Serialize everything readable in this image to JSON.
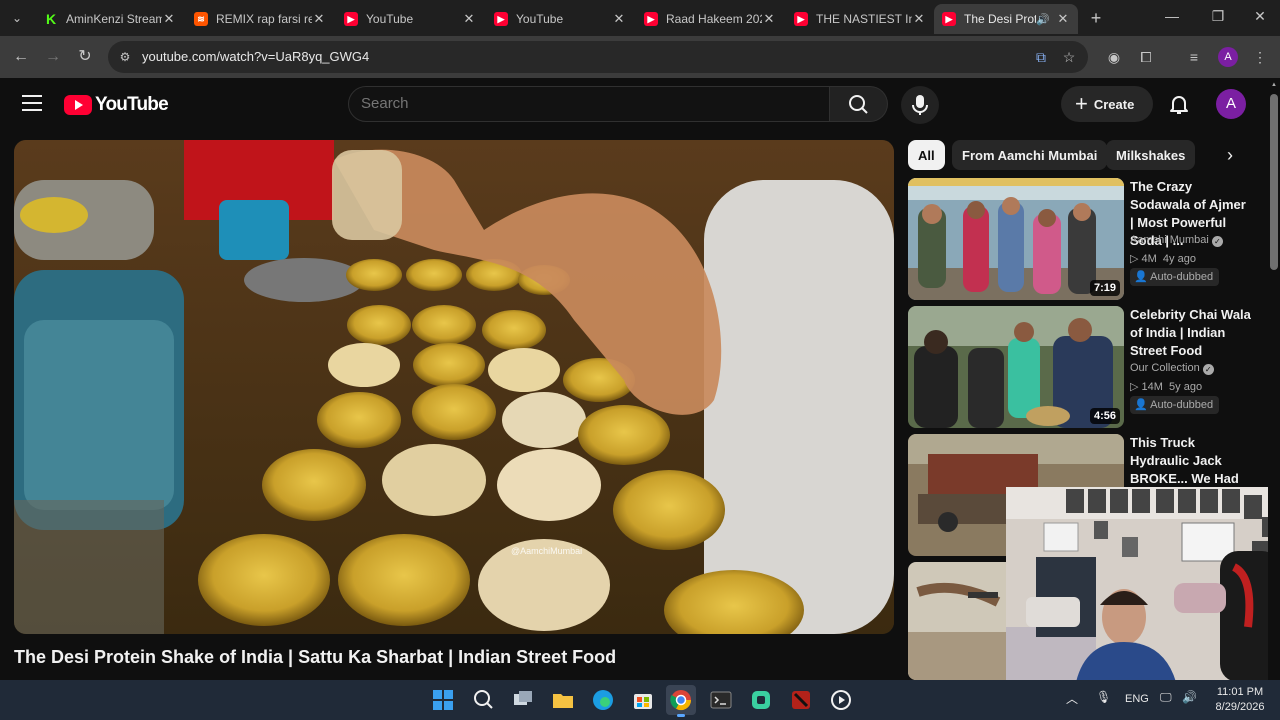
{
  "browser": {
    "tabs": [
      {
        "title": "AminKenzi Stream",
        "favicon": "kick-icon",
        "active": false
      },
      {
        "title": "REMIX rap farsi re",
        "favicon": "soundcloud-icon",
        "active": false
      },
      {
        "title": "YouTube",
        "favicon": "youtube-icon",
        "active": false
      },
      {
        "title": "YouTube",
        "favicon": "youtube-icon",
        "active": false
      },
      {
        "title": "Raad Hakeem 202",
        "favicon": "youtube-icon",
        "active": false
      },
      {
        "title": "THE NASTIEST Ind",
        "favicon": "youtube-icon",
        "active": false
      },
      {
        "title": "The Desi Prote",
        "favicon": "youtube-icon",
        "active": true,
        "audio": true
      }
    ],
    "url": "youtube.com/watch?v=UaR8yq_GWG4",
    "profile_initial": "A"
  },
  "youtube": {
    "logo_text": "YouTube",
    "search_placeholder": "Search",
    "create_label": "Create",
    "avatar_initial": "A",
    "video_title": "The Desi Protein Shake of India | Sattu Ka Sharbat | Indian Street Food",
    "video_watermark": "@AamchiMumbai",
    "chips": [
      "All",
      "From Aamchi Mumbai",
      "Milkshakes"
    ],
    "recommended": [
      {
        "title": "The Crazy Sodawala of Ajmer | Most Powerful Soda | ...",
        "channel": "Aamchi Mumbai",
        "verified": true,
        "views": "4M",
        "age": "4y ago",
        "badge": "Auto-dubbed",
        "duration": "7:19"
      },
      {
        "title": "Celebrity Chai Wala of India | Indian Street Food",
        "channel": "Our Collection",
        "verified": true,
        "views": "14M",
        "age": "5y ago",
        "badge": "Auto-dubbed",
        "duration": "4:56"
      },
      {
        "title": "This Truck Hydraulic Jack BROKE... We Had to Rebuild the ...",
        "channel": "",
        "views": "",
        "age": "",
        "badge": "",
        "duration": ""
      }
    ]
  },
  "taskbar": {
    "language": "ENG",
    "time": "11:01 PM",
    "date": "8/29/2026",
    "apps": [
      "windows-start-icon",
      "search-icon",
      "task-view-icon",
      "file-explorer-icon",
      "edge-icon",
      "store-icon",
      "chrome-icon",
      "terminal-icon",
      "teams-icon",
      "dota-icon",
      "media-player-icon"
    ]
  },
  "colors": {
    "youtube_red": "#ff0033",
    "page_bg": "#0f0f0f",
    "avatar_purple": "#7b1fa2"
  }
}
